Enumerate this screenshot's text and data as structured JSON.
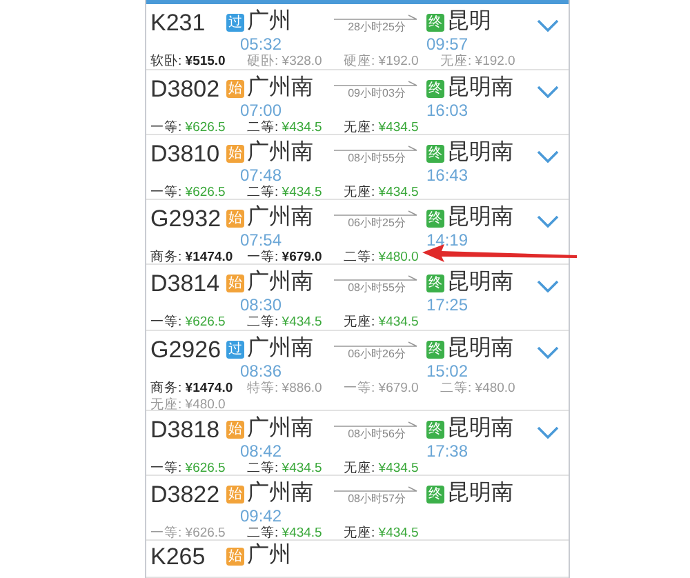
{
  "trains": [
    {
      "number": "K231",
      "from_badge": {
        "text": "过",
        "kind": "pass"
      },
      "from": "广州",
      "depart": "05:32",
      "duration": "28小时25分",
      "to_badge": "终",
      "to": "昆明",
      "arrive": "09:57",
      "prices": [
        {
          "label": "软卧:",
          "value": "¥515.0",
          "disabled": false,
          "scarce": true
        },
        {
          "label": "硬卧:",
          "value": "¥328.0",
          "disabled": true,
          "scarce": false
        },
        {
          "label": "硬座:",
          "value": "¥192.0",
          "disabled": true,
          "scarce": false
        },
        {
          "label": "无座:",
          "value": "¥192.0",
          "disabled": true,
          "scarce": false
        }
      ]
    },
    {
      "number": "D3802",
      "from_badge": {
        "text": "始",
        "kind": "origin"
      },
      "from": "广州南",
      "depart": "07:00",
      "duration": "09小时03分",
      "to_badge": "终",
      "to": "昆明南",
      "arrive": "16:03",
      "prices": [
        {
          "label": "一等:",
          "value": "¥626.5",
          "disabled": false,
          "scarce": false
        },
        {
          "label": "二等:",
          "value": "¥434.5",
          "disabled": false,
          "scarce": false
        },
        {
          "label": "无座:",
          "value": "¥434.5",
          "disabled": false,
          "scarce": false
        }
      ]
    },
    {
      "number": "D3810",
      "from_badge": {
        "text": "始",
        "kind": "origin"
      },
      "from": "广州南",
      "depart": "07:48",
      "duration": "08小时55分",
      "to_badge": "终",
      "to": "昆明南",
      "arrive": "16:43",
      "prices": [
        {
          "label": "一等:",
          "value": "¥626.5",
          "disabled": false,
          "scarce": false
        },
        {
          "label": "二等:",
          "value": "¥434.5",
          "disabled": false,
          "scarce": false
        },
        {
          "label": "无座:",
          "value": "¥434.5",
          "disabled": false,
          "scarce": false
        }
      ]
    },
    {
      "number": "G2932",
      "from_badge": {
        "text": "始",
        "kind": "origin"
      },
      "from": "广州南",
      "depart": "07:54",
      "duration": "06小时25分",
      "to_badge": "终",
      "to": "昆明南",
      "arrive": "14:19",
      "prices": [
        {
          "label": "商务:",
          "value": "¥1474.0",
          "disabled": false,
          "scarce": true
        },
        {
          "label": "一等:",
          "value": "¥679.0",
          "disabled": false,
          "scarce": true
        },
        {
          "label": "二等:",
          "value": "¥480.0",
          "disabled": false,
          "scarce": false
        }
      ]
    },
    {
      "number": "D3814",
      "from_badge": {
        "text": "始",
        "kind": "origin"
      },
      "from": "广州南",
      "depart": "08:30",
      "duration": "08小时55分",
      "to_badge": "终",
      "to": "昆明南",
      "arrive": "17:25",
      "prices": [
        {
          "label": "一等:",
          "value": "¥626.5",
          "disabled": false,
          "scarce": false
        },
        {
          "label": "二等:",
          "value": "¥434.5",
          "disabled": false,
          "scarce": false
        },
        {
          "label": "无座:",
          "value": "¥434.5",
          "disabled": false,
          "scarce": false
        }
      ]
    },
    {
      "number": "G2926",
      "from_badge": {
        "text": "过",
        "kind": "pass"
      },
      "from": "广州南",
      "depart": "08:36",
      "duration": "06小时26分",
      "to_badge": "终",
      "to": "昆明南",
      "arrive": "15:02",
      "prices": [
        {
          "label": "商务:",
          "value": "¥1474.0",
          "disabled": false,
          "scarce": true
        },
        {
          "label": "特等:",
          "value": "¥886.0",
          "disabled": true,
          "scarce": false
        },
        {
          "label": "一等:",
          "value": "¥679.0",
          "disabled": true,
          "scarce": false
        },
        {
          "label": "二等:",
          "value": "¥480.0",
          "disabled": true,
          "scarce": false
        },
        {
          "label": "无座:",
          "value": "¥480.0",
          "disabled": true,
          "scarce": false
        }
      ]
    },
    {
      "number": "D3818",
      "from_badge": {
        "text": "始",
        "kind": "origin"
      },
      "from": "广州南",
      "depart": "08:42",
      "duration": "08小时56分",
      "to_badge": "终",
      "to": "昆明南",
      "arrive": "17:38",
      "prices": [
        {
          "label": "一等:",
          "value": "¥626.5",
          "disabled": false,
          "scarce": false
        },
        {
          "label": "二等:",
          "value": "¥434.5",
          "disabled": false,
          "scarce": false
        },
        {
          "label": "无座:",
          "value": "¥434.5",
          "disabled": false,
          "scarce": false
        }
      ]
    },
    {
      "number": "D3822",
      "from_badge": {
        "text": "始",
        "kind": "origin"
      },
      "from": "广州南",
      "depart": "09:42",
      "duration": "08小时57分",
      "to_badge": "终",
      "to": "昆明南",
      "prices": [
        {
          "label": "一等:",
          "value": "¥626.5",
          "disabled": true,
          "scarce": false
        },
        {
          "label": "二等:",
          "value": "¥434.5",
          "disabled": false,
          "scarce": false
        },
        {
          "label": "无座:",
          "value": "¥434.5",
          "disabled": false,
          "scarce": false
        }
      ]
    },
    {
      "number": "K265",
      "from_badge": {
        "text": "始",
        "kind": "origin"
      },
      "from": "广州"
    }
  ]
}
